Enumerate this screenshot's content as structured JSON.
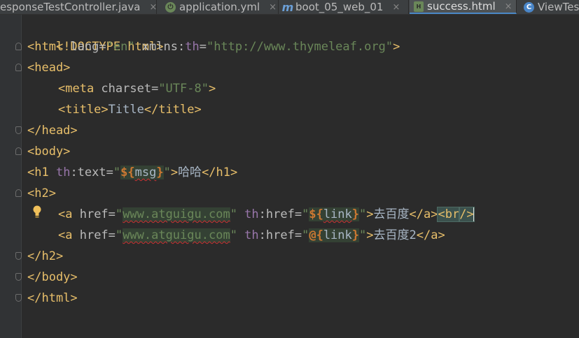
{
  "tabs": [
    {
      "label": "esponseTestController.java",
      "icon": "java-class-icon"
    },
    {
      "label": "application.yml",
      "icon": "spring-icon"
    },
    {
      "label": "boot_05_web_01",
      "icon": "maven-module-icon"
    },
    {
      "label": "success.html",
      "icon": "html-file-icon",
      "active": true
    },
    {
      "label": "ViewTes",
      "icon": "class-c-icon"
    }
  ],
  "close_glyph": "×",
  "code": {
    "l1": "<!DOCTYPE html>",
    "l2": {
      "open": "<html",
      "a1": " lang=",
      "v1": "\"en\"",
      "a2": " xmlns:",
      "ns": "th",
      "eq": "=",
      "v2": "\"http://www.thymeleaf.org\"",
      "close": ">"
    },
    "l3": "<head>",
    "l4": {
      "open": "<meta",
      "a": " charset=",
      "v": "\"UTF-8\"",
      "close": ">"
    },
    "l5": {
      "open": "<title>",
      "text": "Title",
      "close": "</title>"
    },
    "l6": "</head>",
    "l7": "<body>",
    "l8": {
      "open": "<h1",
      "ns": " th",
      "a": ":text=",
      "q1": "\"",
      "e1": "${",
      "var": "msg",
      "e2": "}",
      "q2": "\"",
      "gt": ">",
      "text": "哈哈",
      "close": "</h1>"
    },
    "l9": "<h2>",
    "l10": {
      "open": "<a",
      "a1": " href=",
      "q1": "\"",
      "url": "www.atguigu.com",
      "q2": "\"",
      "ns": " th",
      "a2": ":href=",
      "q3": "\"",
      "e1": "${",
      "var": "link",
      "e2": "}",
      "q4": "\"",
      "gt": ">",
      "text": "去百度",
      "close": "</a>",
      "br_open": "<br",
      "br_close": "/>"
    },
    "l11": {
      "open": "<a",
      "a1": " href=",
      "q1": "\"",
      "url": "www.atguigu.com",
      "q2": "\"",
      "ns": " th",
      "a2": ":href=",
      "q3": "\"",
      "e1": "@{",
      "var": "link",
      "e2": "}",
      "q4": "\"",
      "gt": ">",
      "text": "去百度2",
      "close": "</a>"
    },
    "l12": "</h2>",
    "l13": "</body>",
    "l14": "</html>"
  }
}
